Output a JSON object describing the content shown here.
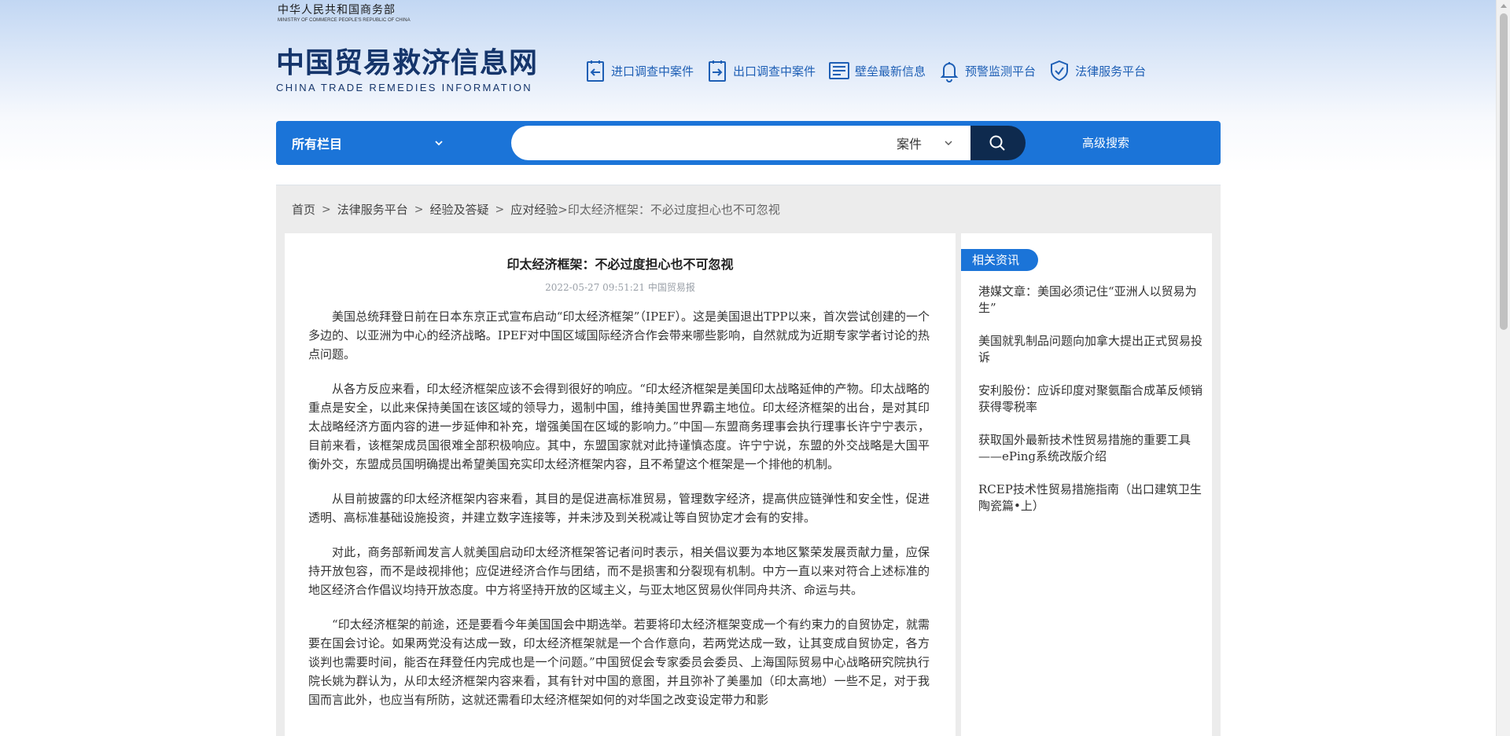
{
  "header": {
    "ministry_cn": "中华人民共和国商务部",
    "ministry_en": "MINISTRY OF COMMERCE PEOPLE'S REPUBLIC OF CHINA",
    "logo_cn": "中国贸易救济信息网",
    "logo_en": "CHINA TRADE REMEDIES INFORMATION"
  },
  "nav": [
    {
      "label": "进口调查中案件",
      "icon": "import-case-icon"
    },
    {
      "label": "出口调查中案件",
      "icon": "export-case-icon"
    },
    {
      "label": "壁垒最新信息",
      "icon": "barrier-info-icon"
    },
    {
      "label": "预警监测平台",
      "icon": "bell-icon"
    },
    {
      "label": "法律服务平台",
      "icon": "shield-check-icon"
    }
  ],
  "search": {
    "scope_label": "所有栏目",
    "placeholder": "",
    "type_label": "案件",
    "advanced_label": "高级搜索"
  },
  "breadcrumb": {
    "items": [
      "首页",
      "法律服务平台",
      "经验及答疑",
      "应对经验"
    ],
    "current": ">印太经济框架：不必过度担心也不可忽视"
  },
  "article": {
    "title": "印太经济框架：不必过度担心也不可忽视",
    "meta": "2022-05-27 09:51:21 中国贸易报",
    "paragraphs": [
      "美国总统拜登日前在日本东京正式宣布启动“印太经济框架”（IPEF）。这是美国退出TPP以来，首次尝试创建的一个多边的、以亚洲为中心的经济战略。IPEF对中国区域国际经济合作会带来哪些影响，自然就成为近期专家学者讨论的热点问题。",
      "从各方反应来看，印太经济框架应该不会得到很好的响应。“印太经济框架是美国印太战略延伸的产物。印太战略的重点是安全，以此来保持美国在该区域的领导力，遏制中国，维持美国世界霸主地位。印太经济框架的出台，是对其印太战略经济方面内容的进一步延伸和补充，增强美国在区域的影响力。”中国—东盟商务理事会执行理事长许宁宁表示，目前来看，该框架成员国很难全部积极响应。其中，东盟国家就对此持谨慎态度。许宁宁说，东盟的外交战略是大国平衡外交，东盟成员国明确提出希望美国充实印太经济框架内容，且不希望这个框架是一个排他的机制。",
      "从目前披露的印太经济框架内容来看，其目的是促进高标准贸易，管理数字经济，提高供应链弹性和安全性，促进透明、高标准基础设施投资，并建立数字连接等，并未涉及到关税减让等自贸协定才会有的安排。",
      "对此，商务部新闻发言人就美国启动印太经济框架答记者问时表示，相关倡议要为本地区繁荣发展贡献力量，应保持开放包容，而不是歧视排他；应促进经济合作与团结，而不是损害和分裂现有机制。中方一直以来对符合上述标准的地区经济合作倡议均持开放态度。中方将坚持开放的区域主义，与亚太地区贸易伙伴同舟共济、命运与共。",
      "“印太经济框架的前途，还是要看今年美国国会中期选举。若要将印太经济框架变成一个有约束力的自贸协定，就需要在国会讨论。如果两党没有达成一致，印太经济框架就是一个合作意向，若两党达成一致，让其变成自贸协定，各方谈判也需要时间，能否在拜登任内完成也是一个问题。”中国贸促会专家委员会委员、上海国际贸易中心战略研究院执行院长姚为群认为，从印太经济框架内容来看，其有针对中国的意图，并且弥补了美墨加（印太高地）一些不足，对于我国而言此外，也应当有所防，这就还需看印太经济框架如何的对华国之改变设定带力和影"
    ]
  },
  "sidebar": {
    "title": "相关资讯",
    "items": [
      "港媒文章：美国必须记住“亚洲人以贸易为生”",
      "美国就乳制品问题向加拿大提出正式贸易投诉",
      "安利股份：应诉印度对聚氨酯合成革反倾销获得零税率",
      "获取国外最新技术性贸易措施的重要工具——ePing系统改版介绍",
      "RCEP技术性贸易措施指南（出口建筑卫生陶瓷篇•上）"
    ]
  },
  "colors": {
    "brand_blue": "#1b74d8",
    "logo_navy": "#15356b",
    "search_btn": "#0e2a4e"
  }
}
